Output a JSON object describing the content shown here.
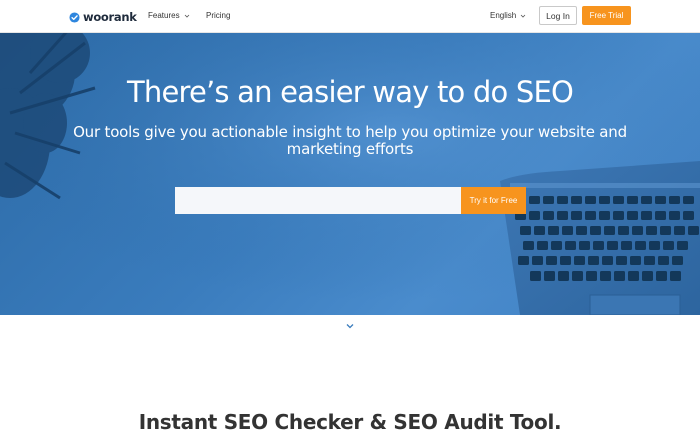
{
  "colors": {
    "accent": "#f7941e",
    "hero_blue": "#3a7cbd",
    "logo_blue": "#2e86de",
    "text_dark": "#333333"
  },
  "header": {
    "logo_text": "woorank",
    "logo_icon": "check-badge-icon",
    "nav": [
      {
        "label": "Features",
        "has_dropdown": true
      },
      {
        "label": "Pricing",
        "has_dropdown": false
      }
    ],
    "language": "English",
    "login_label": "Log In",
    "trial_label": "Free Trial"
  },
  "hero": {
    "title": "There’s an easier way to do SEO",
    "subtitle_line1": "Our tools give you actionable insight to help you optimize your website and",
    "subtitle_line2": "marketing efforts",
    "search_placeholder": "",
    "search_value": "",
    "cta_label": "Try it for Free"
  },
  "scroll_icon": "chevron-down-icon",
  "section": {
    "title": "Instant SEO Checker & SEO Audit Tool."
  }
}
